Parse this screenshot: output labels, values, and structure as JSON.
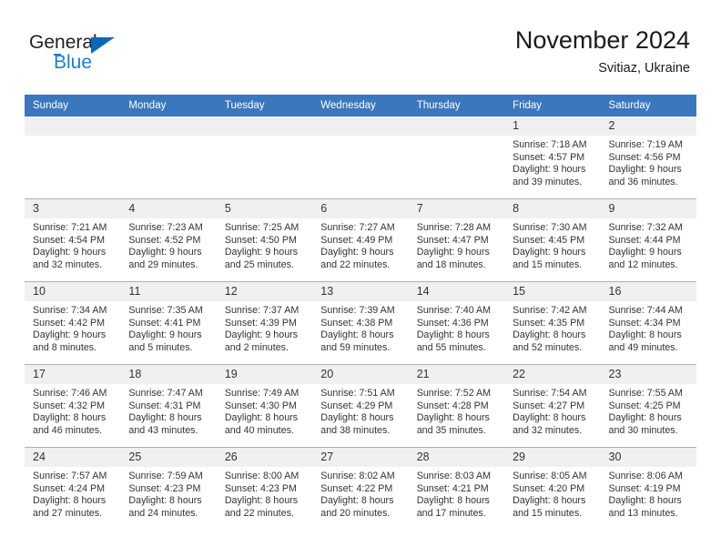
{
  "brand": {
    "name_part1": "General",
    "name_part2": "Blue",
    "triangle_color": "#0b6ab8",
    "blue_color": "#1b7fd4"
  },
  "header": {
    "title": "November 2024",
    "subtitle": "Svitiaz, Ukraine",
    "header_bg": "#3b77bc",
    "header_text_color": "#ffffff"
  },
  "calendar": {
    "weekday_headers": [
      "Sunday",
      "Monday",
      "Tuesday",
      "Wednesday",
      "Thursday",
      "Friday",
      "Saturday"
    ],
    "weeks": [
      [
        {
          "day": "",
          "lines": []
        },
        {
          "day": "",
          "lines": []
        },
        {
          "day": "",
          "lines": []
        },
        {
          "day": "",
          "lines": []
        },
        {
          "day": "",
          "lines": []
        },
        {
          "day": "1",
          "lines": [
            "Sunrise: 7:18 AM",
            "Sunset: 4:57 PM",
            "Daylight: 9 hours",
            "and 39 minutes."
          ]
        },
        {
          "day": "2",
          "lines": [
            "Sunrise: 7:19 AM",
            "Sunset: 4:56 PM",
            "Daylight: 9 hours",
            "and 36 minutes."
          ]
        }
      ],
      [
        {
          "day": "3",
          "lines": [
            "Sunrise: 7:21 AM",
            "Sunset: 4:54 PM",
            "Daylight: 9 hours",
            "and 32 minutes."
          ]
        },
        {
          "day": "4",
          "lines": [
            "Sunrise: 7:23 AM",
            "Sunset: 4:52 PM",
            "Daylight: 9 hours",
            "and 29 minutes."
          ]
        },
        {
          "day": "5",
          "lines": [
            "Sunrise: 7:25 AM",
            "Sunset: 4:50 PM",
            "Daylight: 9 hours",
            "and 25 minutes."
          ]
        },
        {
          "day": "6",
          "lines": [
            "Sunrise: 7:27 AM",
            "Sunset: 4:49 PM",
            "Daylight: 9 hours",
            "and 22 minutes."
          ]
        },
        {
          "day": "7",
          "lines": [
            "Sunrise: 7:28 AM",
            "Sunset: 4:47 PM",
            "Daylight: 9 hours",
            "and 18 minutes."
          ]
        },
        {
          "day": "8",
          "lines": [
            "Sunrise: 7:30 AM",
            "Sunset: 4:45 PM",
            "Daylight: 9 hours",
            "and 15 minutes."
          ]
        },
        {
          "day": "9",
          "lines": [
            "Sunrise: 7:32 AM",
            "Sunset: 4:44 PM",
            "Daylight: 9 hours",
            "and 12 minutes."
          ]
        }
      ],
      [
        {
          "day": "10",
          "lines": [
            "Sunrise: 7:34 AM",
            "Sunset: 4:42 PM",
            "Daylight: 9 hours",
            "and 8 minutes."
          ]
        },
        {
          "day": "11",
          "lines": [
            "Sunrise: 7:35 AM",
            "Sunset: 4:41 PM",
            "Daylight: 9 hours",
            "and 5 minutes."
          ]
        },
        {
          "day": "12",
          "lines": [
            "Sunrise: 7:37 AM",
            "Sunset: 4:39 PM",
            "Daylight: 9 hours",
            "and 2 minutes."
          ]
        },
        {
          "day": "13",
          "lines": [
            "Sunrise: 7:39 AM",
            "Sunset: 4:38 PM",
            "Daylight: 8 hours",
            "and 59 minutes."
          ]
        },
        {
          "day": "14",
          "lines": [
            "Sunrise: 7:40 AM",
            "Sunset: 4:36 PM",
            "Daylight: 8 hours",
            "and 55 minutes."
          ]
        },
        {
          "day": "15",
          "lines": [
            "Sunrise: 7:42 AM",
            "Sunset: 4:35 PM",
            "Daylight: 8 hours",
            "and 52 minutes."
          ]
        },
        {
          "day": "16",
          "lines": [
            "Sunrise: 7:44 AM",
            "Sunset: 4:34 PM",
            "Daylight: 8 hours",
            "and 49 minutes."
          ]
        }
      ],
      [
        {
          "day": "17",
          "lines": [
            "Sunrise: 7:46 AM",
            "Sunset: 4:32 PM",
            "Daylight: 8 hours",
            "and 46 minutes."
          ]
        },
        {
          "day": "18",
          "lines": [
            "Sunrise: 7:47 AM",
            "Sunset: 4:31 PM",
            "Daylight: 8 hours",
            "and 43 minutes."
          ]
        },
        {
          "day": "19",
          "lines": [
            "Sunrise: 7:49 AM",
            "Sunset: 4:30 PM",
            "Daylight: 8 hours",
            "and 40 minutes."
          ]
        },
        {
          "day": "20",
          "lines": [
            "Sunrise: 7:51 AM",
            "Sunset: 4:29 PM",
            "Daylight: 8 hours",
            "and 38 minutes."
          ]
        },
        {
          "day": "21",
          "lines": [
            "Sunrise: 7:52 AM",
            "Sunset: 4:28 PM",
            "Daylight: 8 hours",
            "and 35 minutes."
          ]
        },
        {
          "day": "22",
          "lines": [
            "Sunrise: 7:54 AM",
            "Sunset: 4:27 PM",
            "Daylight: 8 hours",
            "and 32 minutes."
          ]
        },
        {
          "day": "23",
          "lines": [
            "Sunrise: 7:55 AM",
            "Sunset: 4:25 PM",
            "Daylight: 8 hours",
            "and 30 minutes."
          ]
        }
      ],
      [
        {
          "day": "24",
          "lines": [
            "Sunrise: 7:57 AM",
            "Sunset: 4:24 PM",
            "Daylight: 8 hours",
            "and 27 minutes."
          ]
        },
        {
          "day": "25",
          "lines": [
            "Sunrise: 7:59 AM",
            "Sunset: 4:23 PM",
            "Daylight: 8 hours",
            "and 24 minutes."
          ]
        },
        {
          "day": "26",
          "lines": [
            "Sunrise: 8:00 AM",
            "Sunset: 4:23 PM",
            "Daylight: 8 hours",
            "and 22 minutes."
          ]
        },
        {
          "day": "27",
          "lines": [
            "Sunrise: 8:02 AM",
            "Sunset: 4:22 PM",
            "Daylight: 8 hours",
            "and 20 minutes."
          ]
        },
        {
          "day": "28",
          "lines": [
            "Sunrise: 8:03 AM",
            "Sunset: 4:21 PM",
            "Daylight: 8 hours",
            "and 17 minutes."
          ]
        },
        {
          "day": "29",
          "lines": [
            "Sunrise: 8:05 AM",
            "Sunset: 4:20 PM",
            "Daylight: 8 hours",
            "and 15 minutes."
          ]
        },
        {
          "day": "30",
          "lines": [
            "Sunrise: 8:06 AM",
            "Sunset: 4:19 PM",
            "Daylight: 8 hours",
            "and 13 minutes."
          ]
        }
      ]
    ]
  }
}
